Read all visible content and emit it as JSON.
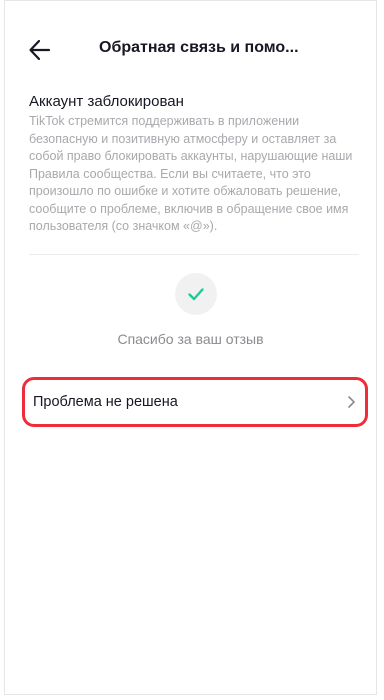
{
  "header": {
    "title": "Обратная связь и помо...",
    "back_icon": "arrow-left-icon"
  },
  "content": {
    "section_title": "Аккаунт заблокирован",
    "description": "TikTok стремится поддерживать в приложении безопасную и позитивную атмосферу и оставляет за собой право блокировать аккаунты, нарушающие наши Правила сообщества. Если вы считаете, что это произошло по ошибке и хотите обжаловать решение, сообщите о проблеме, включив в обращение свое имя пользователя (со значком «@»).",
    "check_icon": "checkmark-icon",
    "thanks_text": "Спасибо за ваш отзыв",
    "problem_row": {
      "label": "Проблема не решена",
      "chevron_icon": "chevron-right-icon"
    }
  },
  "colors": {
    "accent_check": "#20c997",
    "highlight_border": "#ef2d3a",
    "description_text": "#a8a9ad"
  }
}
